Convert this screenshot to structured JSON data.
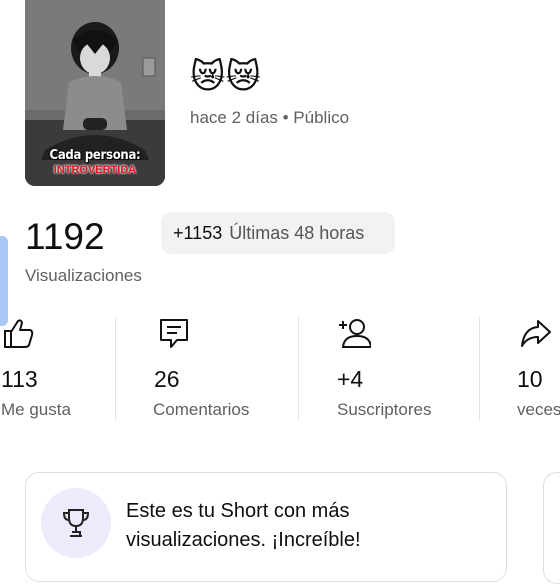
{
  "thumbnail": {
    "caption_line1": "Cada persona:",
    "caption_line2": "INTROVERTIDA"
  },
  "video": {
    "title_emojis": "😿😿",
    "meta": "hace 2 días • Público"
  },
  "views": {
    "value": "1192",
    "label": "Visualizaciones",
    "delta_value": "+1153",
    "delta_label": "Últimas 48 horas"
  },
  "stats": [
    {
      "icon": "thumbs-up-icon",
      "value": "113",
      "label": "Me gusta"
    },
    {
      "icon": "comment-icon",
      "value": "26",
      "label": "Comentarios"
    },
    {
      "icon": "add-person-icon",
      "value": "+4",
      "label": "Suscriptores"
    },
    {
      "icon": "share-icon",
      "value": "10",
      "label": "veces"
    }
  ],
  "highlight_card": {
    "icon": "trophy-icon",
    "line1": "Este es tu Short con más",
    "line2": "visualizaciones. ¡Increíble!"
  },
  "colors": {
    "secondary_text": "#606060",
    "chip_bg": "#f2f2f2",
    "accent_blue": "#a9c7f5",
    "trophy_bg": "#efeafb"
  }
}
